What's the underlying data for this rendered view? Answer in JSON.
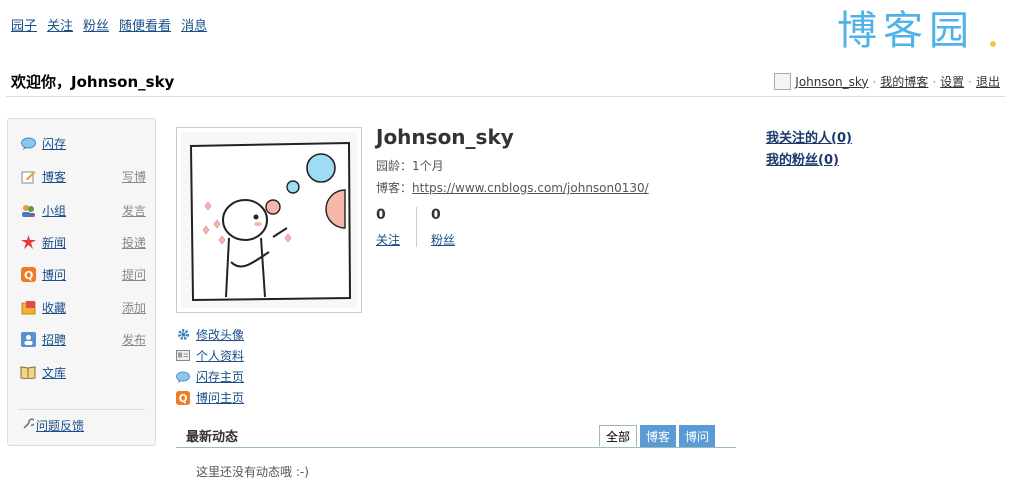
{
  "topnav": [
    "园子",
    "关注",
    "粉丝",
    "随便看看",
    "消息"
  ],
  "logo_text": "博客园",
  "welcome": "欢迎你，Johnson_sky",
  "userbar": {
    "username": "Johnson_sky",
    "my_blog": "我的博客",
    "settings": "设置",
    "logout": "退出",
    "separator": "·"
  },
  "sidebar": {
    "items": [
      {
        "label": "闪存",
        "sub": "",
        "icon": "chat-bubble-icon"
      },
      {
        "label": "博客",
        "sub": "写博",
        "icon": "pen-paper-icon"
      },
      {
        "label": "小组",
        "sub": "发言",
        "icon": "group-icon"
      },
      {
        "label": "新闻",
        "sub": "投递",
        "icon": "news-burst-icon"
      },
      {
        "label": "博问",
        "sub": "提问",
        "icon": "q-icon"
      },
      {
        "label": "收藏",
        "sub": "添加",
        "icon": "bookmark-icon"
      },
      {
        "label": "招聘",
        "sub": "发布",
        "icon": "person-icon"
      },
      {
        "label": "文库",
        "sub": "",
        "icon": "book-icon"
      }
    ],
    "feedback": "问题反馈"
  },
  "photo_links": [
    {
      "label": "修改头像",
      "icon": "gear-icon"
    },
    {
      "label": "个人资料",
      "icon": "id-card-icon"
    },
    {
      "label": "闪存主页",
      "icon": "chat-bubble-icon"
    },
    {
      "label": "博问主页",
      "icon": "q-icon"
    }
  ],
  "profile": {
    "name": "Johnson_sky",
    "age_label": "园龄：",
    "age_value": "1个月",
    "blog_label": "博客：",
    "blog_url": "https://www.cnblogs.com/johnson0130/",
    "following_count": "0",
    "following_label": "关注",
    "followers_count": "0",
    "followers_label": "粉丝"
  },
  "follow_links": {
    "my_following": "我关注的人(0)",
    "my_followers": "我的粉丝(0)"
  },
  "feed": {
    "title": "最新动态",
    "tabs": [
      "全部",
      "博客",
      "博问"
    ],
    "empty_text": "这里还没有动态哦 :-)"
  },
  "colors": {
    "link": "#1a4f8a",
    "tab_active_bg": "#ffffff",
    "tab_inactive_bg": "#5b9bd5",
    "logo_blue": "#4fb3e8",
    "logo_yellow": "#f5c842"
  }
}
